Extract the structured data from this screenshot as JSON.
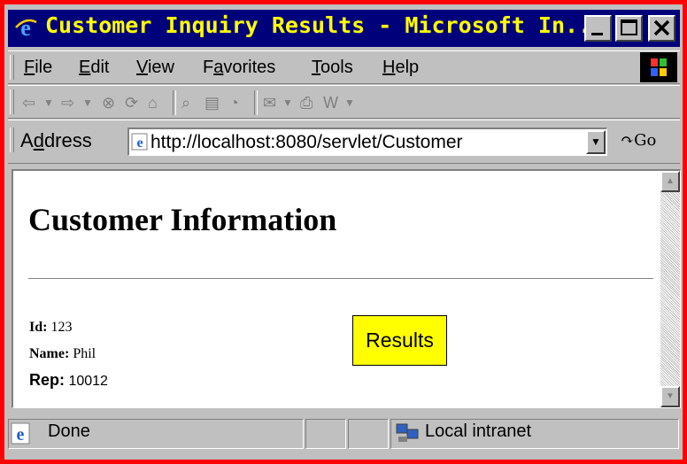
{
  "window": {
    "title": "Customer Inquiry Results - Microsoft In...",
    "controls": [
      "minimize",
      "maximize",
      "close"
    ]
  },
  "menu": {
    "items": [
      {
        "accel": "F",
        "rest": "ile"
      },
      {
        "accel": "E",
        "rest": "dit"
      },
      {
        "accel": "V",
        "rest": "iew"
      },
      {
        "pre": "F",
        "accel": "a",
        "rest": "vorites"
      },
      {
        "accel": "T",
        "rest": "ools"
      },
      {
        "accel": "H",
        "rest": "elp"
      }
    ]
  },
  "address": {
    "label_pre": "A",
    "label_accel": "d",
    "label_rest": "dress",
    "url": "http://localhost:8080/servlet/Customer",
    "go_label": "Go"
  },
  "page": {
    "heading": "Customer Information",
    "fields": {
      "id_label": "Id:",
      "id_value": "123",
      "name_label": "Name:",
      "name_value": "Phil",
      "rep_label": "Rep:",
      "rep_value": "10012"
    },
    "callout": "Results"
  },
  "status": {
    "text": "Done",
    "zone": "Local intranet"
  },
  "colors": {
    "title_bar": "#00007b",
    "title_text": "#ffff00",
    "frame_border": "#ff0000",
    "callout_bg": "#ffff00"
  }
}
